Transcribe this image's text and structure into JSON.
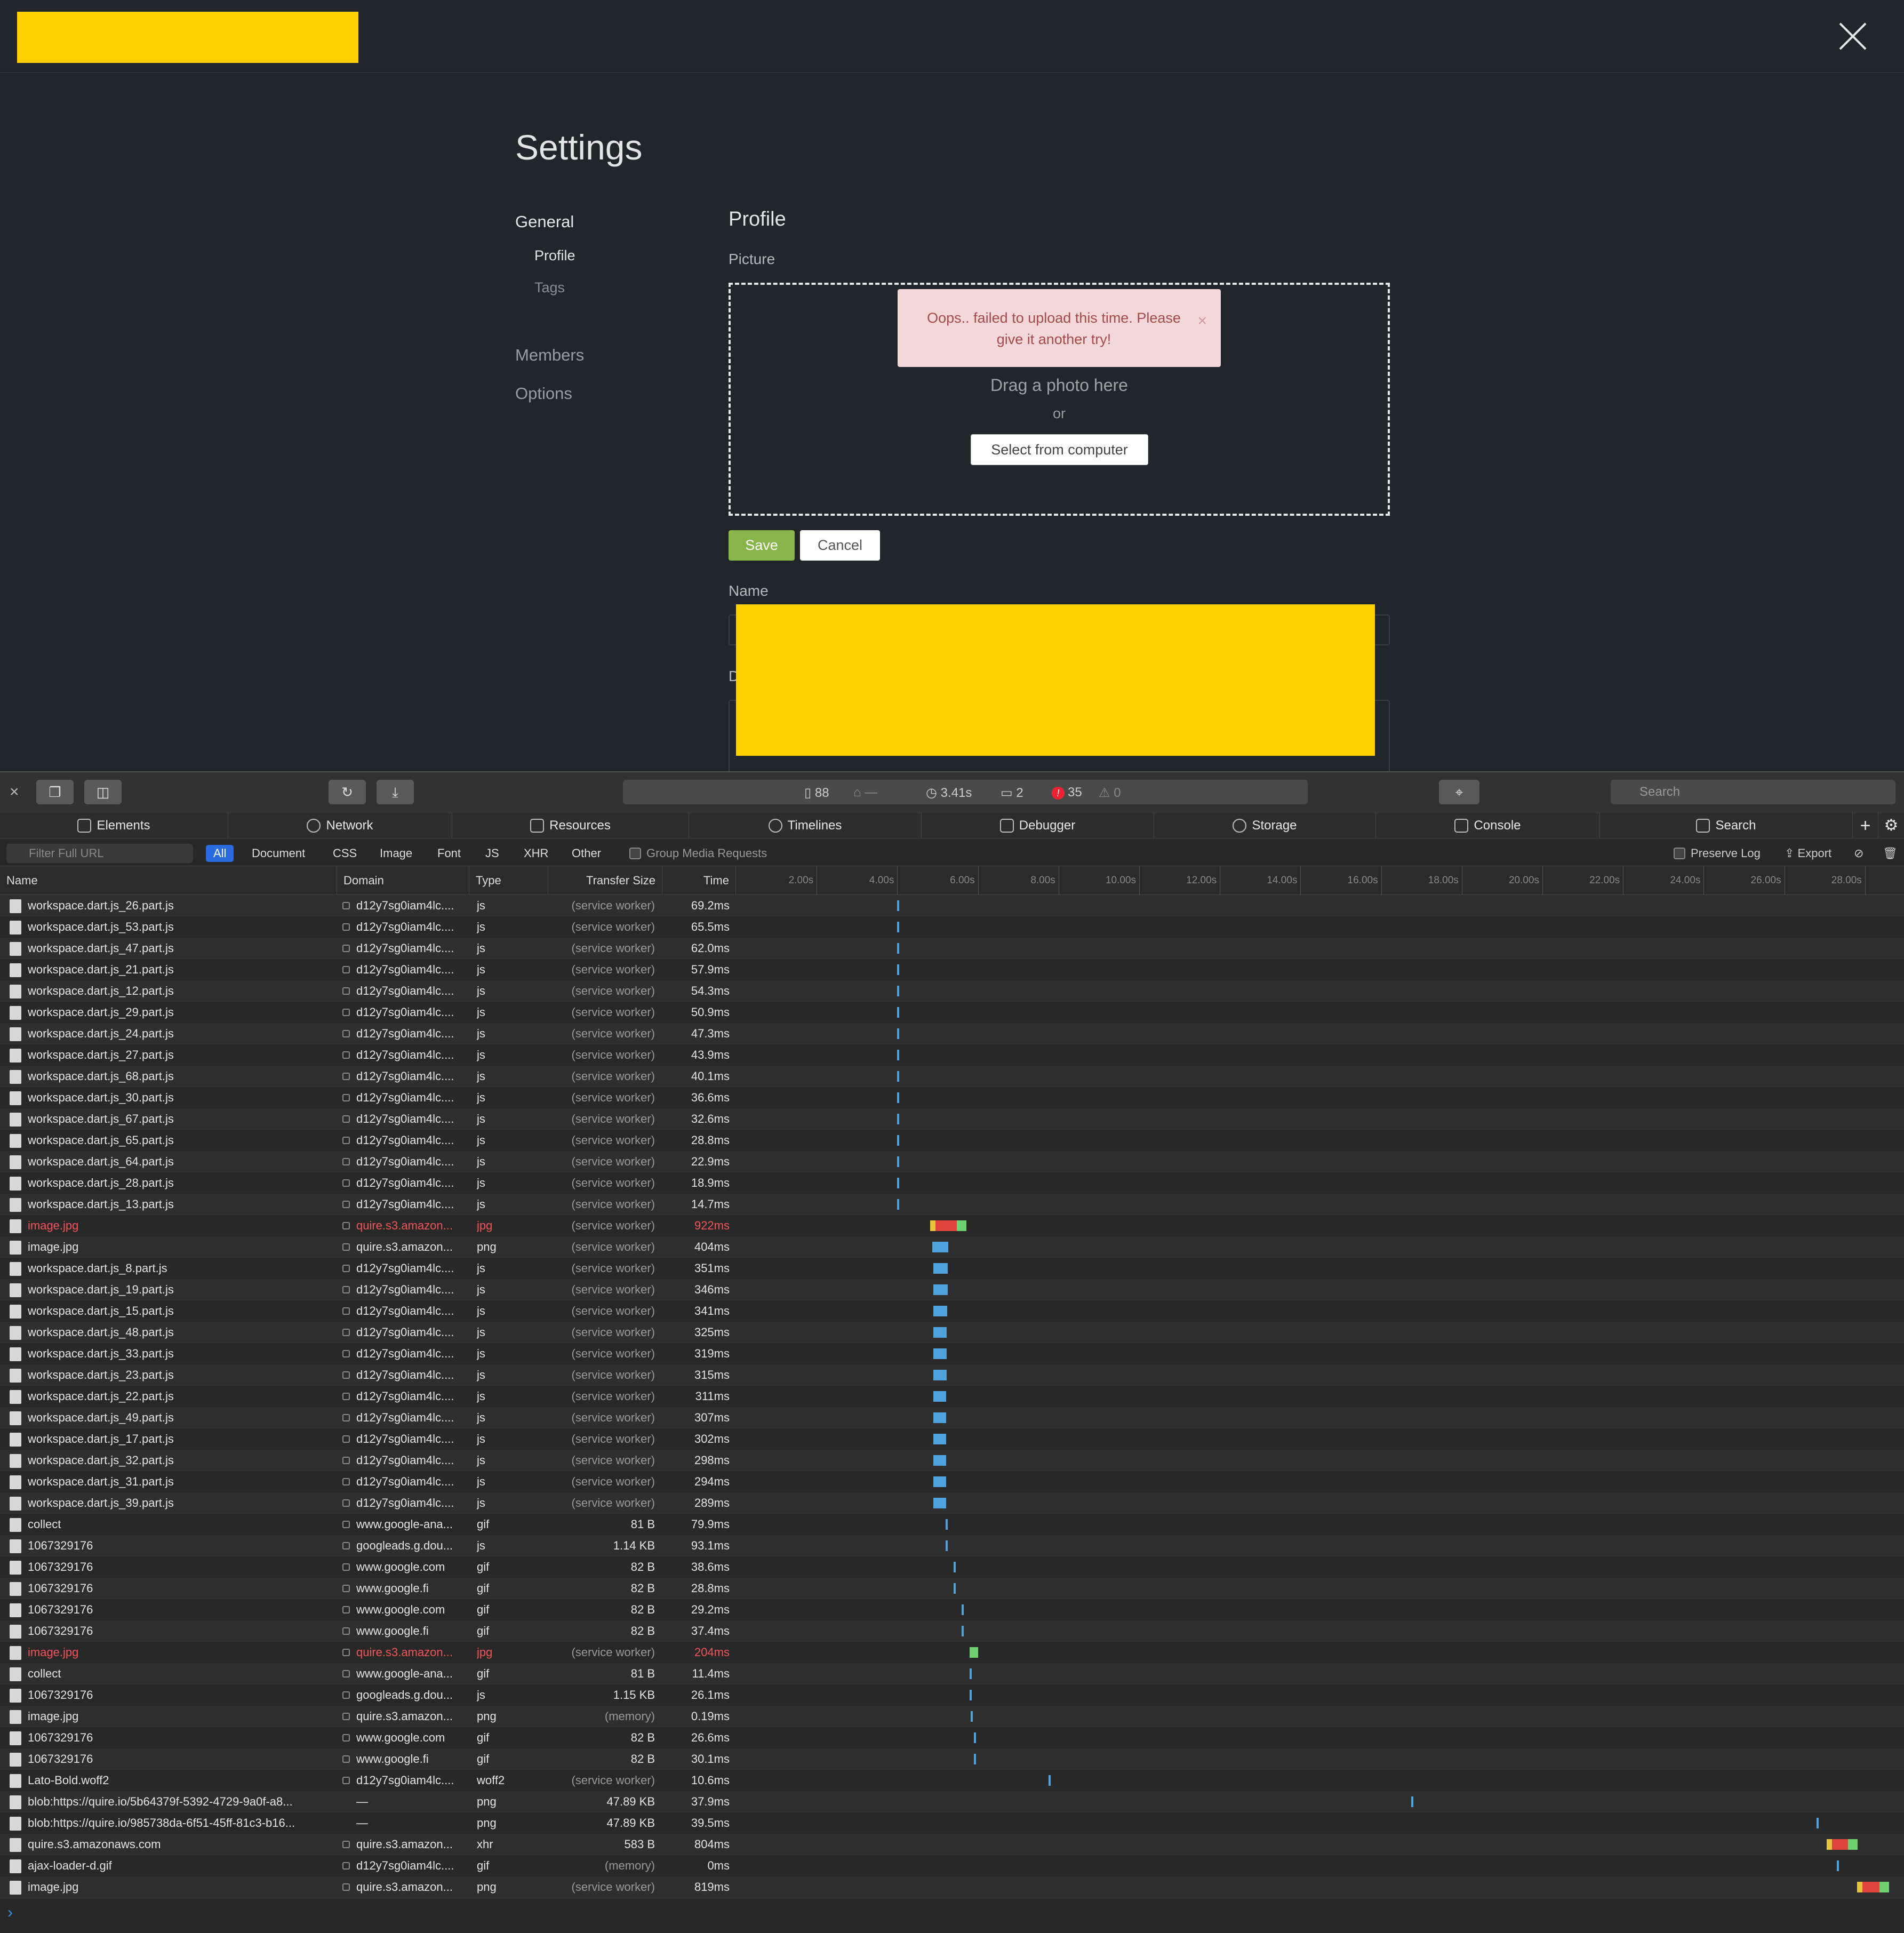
{
  "settings": {
    "title": "Settings",
    "nav": {
      "general": "General",
      "profile": "Profile",
      "tags": "Tags",
      "members": "Members",
      "options": "Options"
    },
    "profile_heading": "Profile",
    "picture_label": "Picture",
    "alert_text": "Oops.. failed to upload this time. Please give it another try!",
    "alert_close": "×",
    "drag_text": "Drag a photo here",
    "or_text": "or",
    "select_button": "Select from computer",
    "save_button": "Save",
    "cancel_button": "Cancel",
    "name_label": "Name",
    "desc_label_partial": "D"
  },
  "devtools": {
    "status": {
      "resources": "88",
      "cached": "—",
      "load_time": "3.41s",
      "messages": "2",
      "errors": "35",
      "warnings": "0"
    },
    "search_placeholder": "Search",
    "tabs": [
      "Elements",
      "Network",
      "Resources",
      "Timelines",
      "Debugger",
      "Storage",
      "Console",
      "Search"
    ],
    "filter_placeholder": "Filter Full URL",
    "filter_types": [
      "All",
      "Document",
      "CSS",
      "Image",
      "Font",
      "JS",
      "XHR",
      "Other"
    ],
    "group_media": "Group Media Requests",
    "preserve_log": "Preserve Log",
    "export": "Export",
    "columns": [
      "Name",
      "Domain",
      "Type",
      "Transfer Size",
      "Time"
    ],
    "timeline_ticks": [
      "2.00s",
      "4.00s",
      "6.00s",
      "8.00s",
      "10.00s",
      "12.00s",
      "14.00s",
      "16.00s",
      "18.00s",
      "20.00s",
      "22.00s",
      "24.00s",
      "26.00s",
      "28.00s"
    ],
    "bar_colors": {
      "blue": "#4fa3dd",
      "green": "#6fd16f",
      "red": "#e0453d",
      "yellow": "#e8c33d"
    },
    "rows": [
      {
        "name": "workspace.dart.js_26.part.js",
        "domain": "d12y7sg0iam4lc....",
        "type": "js",
        "size": "(service worker)",
        "time": "69.2ms",
        "start_s": 3.99,
        "dur_s": 0.07,
        "bar": "tick",
        "error": false
      },
      {
        "name": "workspace.dart.js_53.part.js",
        "domain": "d12y7sg0iam4lc....",
        "type": "js",
        "size": "(service worker)",
        "time": "65.5ms",
        "start_s": 3.99,
        "dur_s": 0.07,
        "bar": "tick",
        "error": false
      },
      {
        "name": "workspace.dart.js_47.part.js",
        "domain": "d12y7sg0iam4lc....",
        "type": "js",
        "size": "(service worker)",
        "time": "62.0ms",
        "start_s": 4.0,
        "dur_s": 0.06,
        "bar": "tick",
        "error": false
      },
      {
        "name": "workspace.dart.js_21.part.js",
        "domain": "d12y7sg0iam4lc....",
        "type": "js",
        "size": "(service worker)",
        "time": "57.9ms",
        "start_s": 4.0,
        "dur_s": 0.06,
        "bar": "tick",
        "error": false
      },
      {
        "name": "workspace.dart.js_12.part.js",
        "domain": "d12y7sg0iam4lc....",
        "type": "js",
        "size": "(service worker)",
        "time": "54.3ms",
        "start_s": 4.0,
        "dur_s": 0.05,
        "bar": "tick",
        "error": false
      },
      {
        "name": "workspace.dart.js_29.part.js",
        "domain": "d12y7sg0iam4lc....",
        "type": "js",
        "size": "(service worker)",
        "time": "50.9ms",
        "start_s": 4.0,
        "dur_s": 0.05,
        "bar": "tick",
        "error": false
      },
      {
        "name": "workspace.dart.js_24.part.js",
        "domain": "d12y7sg0iam4lc....",
        "type": "js",
        "size": "(service worker)",
        "time": "47.3ms",
        "start_s": 4.0,
        "dur_s": 0.05,
        "bar": "tick",
        "error": false
      },
      {
        "name": "workspace.dart.js_27.part.js",
        "domain": "d12y7sg0iam4lc....",
        "type": "js",
        "size": "(service worker)",
        "time": "43.9ms",
        "start_s": 4.0,
        "dur_s": 0.04,
        "bar": "tick",
        "error": false
      },
      {
        "name": "workspace.dart.js_68.part.js",
        "domain": "d12y7sg0iam4lc....",
        "type": "js",
        "size": "(service worker)",
        "time": "40.1ms",
        "start_s": 4.0,
        "dur_s": 0.04,
        "bar": "tick",
        "error": false
      },
      {
        "name": "workspace.dart.js_30.part.js",
        "domain": "d12y7sg0iam4lc....",
        "type": "js",
        "size": "(service worker)",
        "time": "36.6ms",
        "start_s": 4.0,
        "dur_s": 0.04,
        "bar": "tick",
        "error": false
      },
      {
        "name": "workspace.dart.js_67.part.js",
        "domain": "d12y7sg0iam4lc....",
        "type": "js",
        "size": "(service worker)",
        "time": "32.6ms",
        "start_s": 4.0,
        "dur_s": 0.03,
        "bar": "tick",
        "error": false
      },
      {
        "name": "workspace.dart.js_65.part.js",
        "domain": "d12y7sg0iam4lc....",
        "type": "js",
        "size": "(service worker)",
        "time": "28.8ms",
        "start_s": 4.0,
        "dur_s": 0.03,
        "bar": "tick",
        "error": false
      },
      {
        "name": "workspace.dart.js_64.part.js",
        "domain": "d12y7sg0iam4lc....",
        "type": "js",
        "size": "(service worker)",
        "time": "22.9ms",
        "start_s": 4.0,
        "dur_s": 0.02,
        "bar": "tick",
        "error": false
      },
      {
        "name": "workspace.dart.js_28.part.js",
        "domain": "d12y7sg0iam4lc....",
        "type": "js",
        "size": "(service worker)",
        "time": "18.9ms",
        "start_s": 4.0,
        "dur_s": 0.02,
        "bar": "tick",
        "error": false
      },
      {
        "name": "workspace.dart.js_13.part.js",
        "domain": "d12y7sg0iam4lc....",
        "type": "js",
        "size": "(service worker)",
        "time": "14.7ms",
        "start_s": 4.0,
        "dur_s": 0.01,
        "bar": "tick",
        "error": false
      },
      {
        "name": "image.jpg",
        "domain": "quire.s3.amazon...",
        "type": "jpg",
        "size": "(service worker)",
        "time": "922ms",
        "start_s": 4.82,
        "dur_s": 0.92,
        "bar": "multi",
        "error": true
      },
      {
        "name": "image.jpg",
        "domain": "quire.s3.amazon...",
        "type": "png",
        "size": "(service worker)",
        "time": "404ms",
        "start_s": 4.87,
        "dur_s": 0.4,
        "bar": "block",
        "error": false
      },
      {
        "name": "workspace.dart.js_8.part.js",
        "domain": "d12y7sg0iam4lc....",
        "type": "js",
        "size": "(service worker)",
        "time": "351ms",
        "start_s": 4.9,
        "dur_s": 0.35,
        "bar": "block",
        "error": false
      },
      {
        "name": "workspace.dart.js_19.part.js",
        "domain": "d12y7sg0iam4lc....",
        "type": "js",
        "size": "(service worker)",
        "time": "346ms",
        "start_s": 4.9,
        "dur_s": 0.35,
        "bar": "block",
        "error": false
      },
      {
        "name": "workspace.dart.js_15.part.js",
        "domain": "d12y7sg0iam4lc....",
        "type": "js",
        "size": "(service worker)",
        "time": "341ms",
        "start_s": 4.9,
        "dur_s": 0.34,
        "bar": "block",
        "error": false
      },
      {
        "name": "workspace.dart.js_48.part.js",
        "domain": "d12y7sg0iam4lc....",
        "type": "js",
        "size": "(service worker)",
        "time": "325ms",
        "start_s": 4.9,
        "dur_s": 0.33,
        "bar": "block",
        "error": false
      },
      {
        "name": "workspace.dart.js_33.part.js",
        "domain": "d12y7sg0iam4lc....",
        "type": "js",
        "size": "(service worker)",
        "time": "319ms",
        "start_s": 4.9,
        "dur_s": 0.32,
        "bar": "block",
        "error": false
      },
      {
        "name": "workspace.dart.js_23.part.js",
        "domain": "d12y7sg0iam4lc....",
        "type": "js",
        "size": "(service worker)",
        "time": "315ms",
        "start_s": 4.9,
        "dur_s": 0.32,
        "bar": "block",
        "error": false
      },
      {
        "name": "workspace.dart.js_22.part.js",
        "domain": "d12y7sg0iam4lc....",
        "type": "js",
        "size": "(service worker)",
        "time": "311ms",
        "start_s": 4.9,
        "dur_s": 0.31,
        "bar": "block",
        "error": false
      },
      {
        "name": "workspace.dart.js_49.part.js",
        "domain": "d12y7sg0iam4lc....",
        "type": "js",
        "size": "(service worker)",
        "time": "307ms",
        "start_s": 4.9,
        "dur_s": 0.31,
        "bar": "block",
        "error": false
      },
      {
        "name": "workspace.dart.js_17.part.js",
        "domain": "d12y7sg0iam4lc....",
        "type": "js",
        "size": "(service worker)",
        "time": "302ms",
        "start_s": 4.9,
        "dur_s": 0.3,
        "bar": "block",
        "error": false
      },
      {
        "name": "workspace.dart.js_32.part.js",
        "domain": "d12y7sg0iam4lc....",
        "type": "js",
        "size": "(service worker)",
        "time": "298ms",
        "start_s": 4.9,
        "dur_s": 0.3,
        "bar": "block",
        "error": false
      },
      {
        "name": "workspace.dart.js_31.part.js",
        "domain": "d12y7sg0iam4lc....",
        "type": "js",
        "size": "(service worker)",
        "time": "294ms",
        "start_s": 4.9,
        "dur_s": 0.29,
        "bar": "block",
        "error": false
      },
      {
        "name": "workspace.dart.js_39.part.js",
        "domain": "d12y7sg0iam4lc....",
        "type": "js",
        "size": "(service worker)",
        "time": "289ms",
        "start_s": 4.9,
        "dur_s": 0.29,
        "bar": "block",
        "error": false
      },
      {
        "name": "collect",
        "domain": "www.google-ana...",
        "type": "gif",
        "size": "81 B",
        "time": "79.9ms",
        "start_s": 5.2,
        "dur_s": 0.08,
        "bar": "tick",
        "error": false
      },
      {
        "name": "1067329176",
        "domain": "googleads.g.dou...",
        "type": "js",
        "size": "1.14 KB",
        "time": "93.1ms",
        "start_s": 5.2,
        "dur_s": 0.09,
        "bar": "tick",
        "error": false
      },
      {
        "name": "1067329176",
        "domain": "www.google.com",
        "type": "gif",
        "size": "82 B",
        "time": "38.6ms",
        "start_s": 5.4,
        "dur_s": 0.04,
        "bar": "tick",
        "error": false
      },
      {
        "name": "1067329176",
        "domain": "www.google.fi",
        "type": "gif",
        "size": "82 B",
        "time": "28.8ms",
        "start_s": 5.4,
        "dur_s": 0.03,
        "bar": "tick",
        "error": false
      },
      {
        "name": "1067329176",
        "domain": "www.google.com",
        "type": "gif",
        "size": "82 B",
        "time": "29.2ms",
        "start_s": 5.6,
        "dur_s": 0.03,
        "bar": "tick",
        "error": false
      },
      {
        "name": "1067329176",
        "domain": "www.google.fi",
        "type": "gif",
        "size": "82 B",
        "time": "37.4ms",
        "start_s": 5.6,
        "dur_s": 0.04,
        "bar": "tick",
        "error": false
      },
      {
        "name": "image.jpg",
        "domain": "quire.s3.amazon...",
        "type": "jpg",
        "size": "(service worker)",
        "time": "204ms",
        "start_s": 5.8,
        "dur_s": 0.2,
        "bar": "green",
        "error": true
      },
      {
        "name": "collect",
        "domain": "www.google-ana...",
        "type": "gif",
        "size": "81 B",
        "time": "11.4ms",
        "start_s": 5.8,
        "dur_s": 0.01,
        "bar": "tick",
        "error": false
      },
      {
        "name": "1067329176",
        "domain": "googleads.g.dou...",
        "type": "js",
        "size": "1.15 KB",
        "time": "26.1ms",
        "start_s": 5.8,
        "dur_s": 0.03,
        "bar": "tick",
        "error": false
      },
      {
        "name": "image.jpg",
        "domain": "quire.s3.amazon...",
        "type": "png",
        "size": "(memory)",
        "time": "0.19ms",
        "start_s": 5.82,
        "dur_s": 0.0,
        "bar": "tick",
        "error": false
      },
      {
        "name": "1067329176",
        "domain": "www.google.com",
        "type": "gif",
        "size": "82 B",
        "time": "26.6ms",
        "start_s": 5.9,
        "dur_s": 0.03,
        "bar": "tick",
        "error": false
      },
      {
        "name": "1067329176",
        "domain": "www.google.fi",
        "type": "gif",
        "size": "82 B",
        "time": "30.1ms",
        "start_s": 5.9,
        "dur_s": 0.03,
        "bar": "tick",
        "error": false
      },
      {
        "name": "Lato-Bold.woff2",
        "domain": "d12y7sg0iam4lc....",
        "type": "woff2",
        "size": "(service worker)",
        "time": "10.6ms",
        "start_s": 7.75,
        "dur_s": 0.01,
        "bar": "tick",
        "error": false
      },
      {
        "name": "blob:https://quire.io/5b64379f-5392-4729-9a0f-a8...",
        "domain": "—",
        "type": "png",
        "size": "47.89 KB",
        "time": "37.9ms",
        "start_s": 16.75,
        "dur_s": 0.04,
        "bar": "tick",
        "error": false
      },
      {
        "name": "blob:https://quire.io/985738da-6f51-45ff-81c3-b16...",
        "domain": "—",
        "type": "png",
        "size": "47.89 KB",
        "time": "39.5ms",
        "start_s": 26.8,
        "dur_s": 0.04,
        "bar": "tick",
        "error": false
      },
      {
        "name": "quire.s3.amazonaws.com",
        "domain": "quire.s3.amazon...",
        "type": "xhr",
        "size": "583 B",
        "time": "804ms",
        "start_s": 27.05,
        "dur_s": 0.8,
        "bar": "multi",
        "error": false
      },
      {
        "name": "ajax-loader-d.gif",
        "domain": "d12y7sg0iam4lc....",
        "type": "gif",
        "size": "(memory)",
        "time": "0ms",
        "start_s": 27.3,
        "dur_s": 0.0,
        "bar": "tick",
        "error": false
      },
      {
        "name": "image.jpg",
        "domain": "quire.s3.amazon...",
        "type": "png",
        "size": "(service worker)",
        "time": "819ms",
        "start_s": 27.8,
        "dur_s": 0.82,
        "bar": "multi",
        "error": false
      }
    ]
  }
}
